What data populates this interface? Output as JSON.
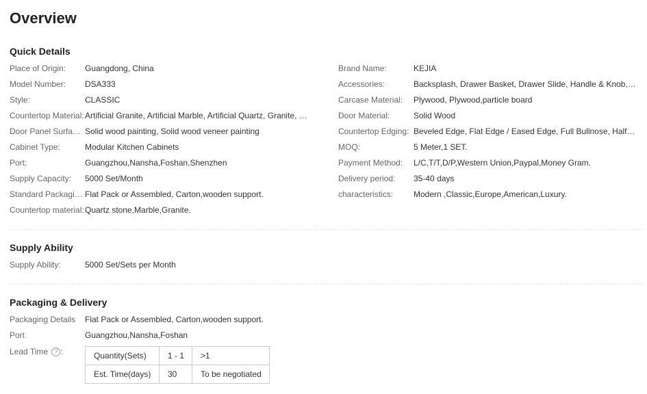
{
  "title": "Overview",
  "quick_details": {
    "heading": "Quick Details",
    "left": [
      {
        "label": "Place of Origin:",
        "value": "Guangdong, China"
      },
      {
        "label": "Model Number:",
        "value": "DSA333"
      },
      {
        "label": "Style:",
        "value": "CLASSIC"
      },
      {
        "label": "Countertop Material:",
        "value": "Artificial Granite, Artificial Marble, Artificial Quartz, Granite, M..."
      },
      {
        "label": "Door Panel Surface...",
        "value": "Solid wood painting, Solid wood veneer painting"
      },
      {
        "label": "Cabinet Type:",
        "value": "Modular Kitchen Cabinets"
      },
      {
        "label": "Port:",
        "value": "Guangzhou,Nansha,Foshan,Shenzhen"
      },
      {
        "label": "Supply Capacity:",
        "value": "5000 Set/Month"
      },
      {
        "label": "Standard Packaging:",
        "value": "Flat Pack or Assembled, Carton,wooden support."
      },
      {
        "label": "Countertop material:",
        "value": "Quartz stone,Marble,Granite."
      }
    ],
    "right": [
      {
        "label": "Brand Name:",
        "value": "KEJIA"
      },
      {
        "label": "Accessories:",
        "value": "Backsplash, Drawer Basket, Drawer Slide, Handle & Knob, Hin..."
      },
      {
        "label": "Carcase Material:",
        "value": "Plywood, Plywood,particle board"
      },
      {
        "label": "Door Material:",
        "value": "Solid Wood"
      },
      {
        "label": "Countertop Edging:",
        "value": "Beveled Edge, Flat Edge / Eased Edge, Full Bullnose, Half Bull..."
      },
      {
        "label": "MOQ:",
        "value": "5 Meter,1 SET."
      },
      {
        "label": "Payment Method:",
        "value": "L/C,T/T,D/P,Western Union,Paypal,Money Gram."
      },
      {
        "label": "Delivery period:",
        "value": "35-40 days"
      },
      {
        "label": "characteristics:",
        "value": "Modern ,Classic,Europe,American,Luxury."
      }
    ]
  },
  "supply_ability": {
    "heading": "Supply Ability",
    "label": "Supply Ability:",
    "value": "5000 Set/Sets per Month"
  },
  "packaging": {
    "heading": "Packaging & Delivery",
    "details_label": "Packaging Details",
    "details_value": "Flat Pack or Assembled, Carton,wooden support.",
    "port_label": "Port",
    "port_value": "Guangzhou,Nansha,Foshan",
    "lead_time_label": "Lead Time",
    "help_icon": "?",
    "lead_table": {
      "header": [
        "Quantity(Sets)",
        "1 - 1",
        ">1"
      ],
      "row": [
        "Est. Time(days)",
        "30",
        "To be negotiated"
      ]
    }
  }
}
